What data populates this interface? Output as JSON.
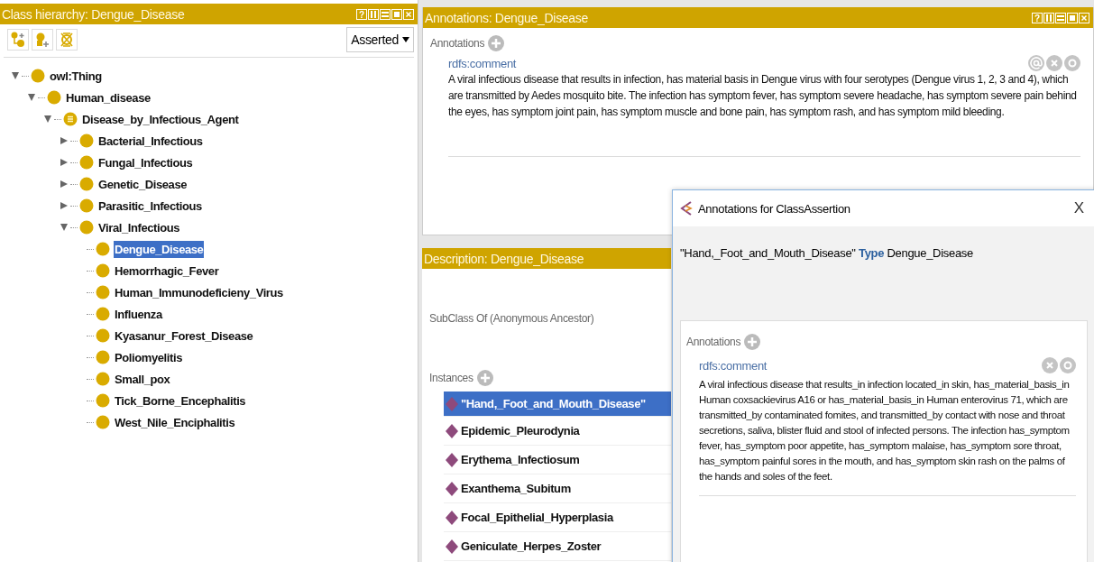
{
  "class_hierarchy": {
    "title": "Class hierarchy: Dengue_Disease",
    "help_label": "?",
    "view_mode": "Asserted",
    "tree": [
      {
        "label": "owl:Thing",
        "kind": "primitive",
        "expanded": true,
        "selected": false,
        "children": [
          {
            "label": "Human_disease",
            "kind": "primitive",
            "expanded": true,
            "selected": false,
            "children": [
              {
                "label": "Disease_by_Infectious_Agent",
                "kind": "defined",
                "expanded": true,
                "selected": false,
                "children": [
                  {
                    "label": "Bacterial_Infectious",
                    "kind": "primitive",
                    "expanded": false,
                    "selected": false
                  },
                  {
                    "label": "Fungal_Infectious",
                    "kind": "primitive",
                    "expanded": false,
                    "selected": false
                  },
                  {
                    "label": "Genetic_Disease",
                    "kind": "primitive",
                    "expanded": false,
                    "selected": false
                  },
                  {
                    "label": "Parasitic_Infectious",
                    "kind": "primitive",
                    "expanded": false,
                    "selected": false
                  },
                  {
                    "label": "Viral_Infectious",
                    "kind": "primitive",
                    "expanded": true,
                    "selected": false,
                    "children": [
                      {
                        "label": "Dengue_Disease",
                        "kind": "primitive",
                        "selected": true
                      },
                      {
                        "label": "Hemorrhagic_Fever",
                        "kind": "primitive",
                        "selected": false
                      },
                      {
                        "label": "Human_Immunodeficieny_Virus",
                        "kind": "primitive",
                        "selected": false
                      },
                      {
                        "label": "Influenza",
                        "kind": "primitive",
                        "selected": false
                      },
                      {
                        "label": "Kyasanur_Forest_Disease",
                        "kind": "primitive",
                        "selected": false
                      },
                      {
                        "label": "Poliomyelitis",
                        "kind": "primitive",
                        "selected": false
                      },
                      {
                        "label": "Small_pox",
                        "kind": "primitive",
                        "selected": false
                      },
                      {
                        "label": "Tick_Borne_Encephalitis",
                        "kind": "primitive",
                        "selected": false
                      },
                      {
                        "label": "West_Nile_Enciphalitis",
                        "kind": "primitive",
                        "selected": false
                      }
                    ]
                  }
                ]
              }
            ]
          }
        ]
      }
    ]
  },
  "annotations_panel": {
    "title": "Annotations: Dengue_Disease",
    "help_label": "?",
    "section_label": "Annotations",
    "annotations": [
      {
        "property": "rdfs:comment",
        "value": "A viral infectious disease that results in infection, has material basis in Dengue virus with four serotypes (Dengue virus 1, 2, 3 and 4), which are transmitted by Aedes mosquito bite. The infection has symptom fever, has symptom severe headache, has symptom severe pain behind the eyes, has symptom joint pain, has symptom muscle and bone pain, has symptom rash, and has symptom mild bleeding."
      }
    ]
  },
  "description_panel": {
    "title": "Description: Dengue_Disease",
    "subclass_label": "SubClass Of (Anonymous Ancestor)",
    "instances_label": "Instances",
    "instances": [
      {
        "label": "\"Hand,_Foot_and_Mouth_Disease\"",
        "selected": true
      },
      {
        "label": "Epidemic_Pleurodynia",
        "selected": false
      },
      {
        "label": "Erythema_Infectiosum",
        "selected": false
      },
      {
        "label": "Exanthema_Subitum",
        "selected": false
      },
      {
        "label": "Focal_Epithelial_Hyperplasia",
        "selected": false
      },
      {
        "label": "Geniculate_Herpes_Zoster",
        "selected": false
      }
    ]
  },
  "dialog": {
    "title": "Annotations for ClassAssertion",
    "close_label": "X",
    "axiom": "\"Hand,_Foot_and_Mouth_Disease\" **Type** Dengue_Disease",
    "section_label": "Annotations",
    "annotations": [
      {
        "property": "rdfs:comment",
        "value": "A viral infectious disease that results_in infection located_in skin, has_material_basis_in Human coxsackievirus A16 or has_material_basis_in Human enterovirus 71, which are transmitted_by contaminated fomites, and transmitted_by contact with nose and throat secretions, saliva, blister fluid and stool of infected persons. The infection has_symptom fever, has_symptom poor appetite, has_symptom malaise, has_symptom sore throat, has_symptom painful sores in the mouth, and has_symptom skin rash on the palms of the hands and soles of the feet."
      }
    ]
  }
}
